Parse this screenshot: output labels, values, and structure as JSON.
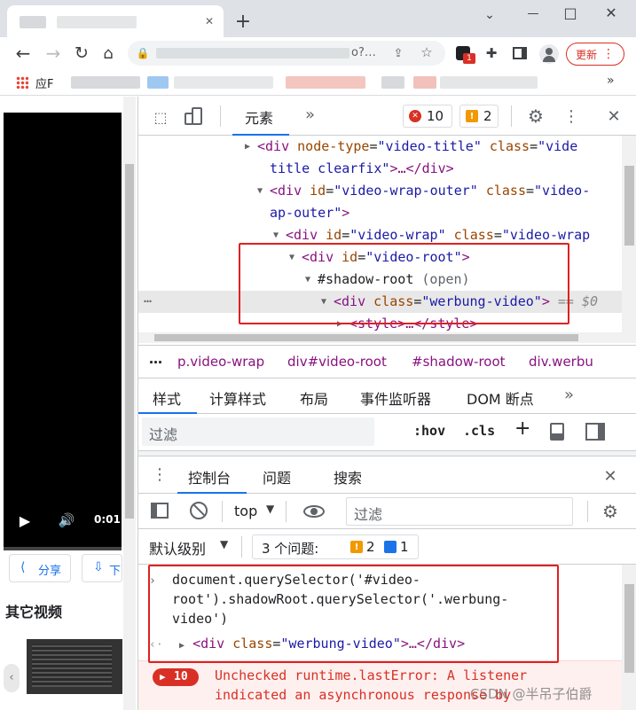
{
  "tabbar": {
    "new_tab": "+",
    "minimize": "—",
    "maximize": "□",
    "close": "✕"
  },
  "addressbar": {
    "url_tail": "o?…",
    "update_label": "更新",
    "ext_badge": "1"
  },
  "bookmarks": {
    "apps_label": "应F",
    "more": "»"
  },
  "page": {
    "video_time": "0:01",
    "share_label": "分享",
    "download_label": "下",
    "other_videos": "其它视频"
  },
  "devtools": {
    "elements_tab": "元素",
    "more_tabs": "»",
    "error_count": "10",
    "warning_count": "2",
    "dom": {
      "line1": {
        "tag_open": "<div ",
        "attr1": "node-type",
        "val1": "\"video-title\"",
        "attr2": "class",
        "val2": "\"vide"
      },
      "line1b": {
        "val": "title clearfix\"",
        "rest": ">…</div>"
      },
      "line2": {
        "tag_open": "<div ",
        "attr1": "id",
        "val1": "\"video-wrap-outer\"",
        "attr2": "class",
        "val2": "\"video-"
      },
      "line2b": {
        "val": "ap-outer\"",
        "rest": ">"
      },
      "line3": {
        "tag_open": "<div ",
        "attr1": "id",
        "val1": "\"video-wrap\"",
        "attr2": "class",
        "val2": "\"video-wrap"
      },
      "line4": {
        "tag_open": "<div ",
        "attr1": "id",
        "val1": "\"video-root\"",
        "close": ">"
      },
      "line5": {
        "text": "#shadow-root",
        "mode": "(open)"
      },
      "line6": {
        "tag_open": "<div ",
        "attr1": "class",
        "val1": "\"werbung-video\"",
        "close": ">",
        "suffix": "== $0"
      },
      "line7": {
        "text": "<style>…</style>"
      }
    },
    "breadcrumb": {
      "dots": "…",
      "items": [
        "p.video-wrap",
        "div#video-root",
        "#shadow-root",
        "div.werbu"
      ]
    },
    "styles_tabs": [
      "样式",
      "计算样式",
      "布局",
      "事件监听器",
      "DOM 断点",
      "»"
    ],
    "filter_placeholder": "过滤",
    "hov": ":hov",
    "cls": ".cls",
    "plus": "+",
    "console_tabs": [
      "控制台",
      "问题",
      "搜索"
    ],
    "console_context": "top",
    "console_filter_placeholder": "过滤",
    "default_levels": "默认级别",
    "issues_label": "3 个问题:",
    "issues_warn": "2",
    "issues_info": "1",
    "console_input_lines": [
      "document.querySelector('#video-",
      "root').shadowRoot.querySelector('.werbung-",
      "video')"
    ],
    "console_result": {
      "tag_open": "<div ",
      "attr": "class",
      "val": "\"werbung-video\"",
      "rest": ">…</div>"
    },
    "error_badge": "10",
    "error_lines": [
      "Unchecked runtime.lastError: A listener",
      "indicated an asynchronous response by"
    ]
  },
  "watermark": "CSDN @半吊子伯爵",
  "colors": {
    "highlight": "#e02020",
    "accent": "#1a73e8",
    "error": "#d93025",
    "warning": "#f29900"
  }
}
